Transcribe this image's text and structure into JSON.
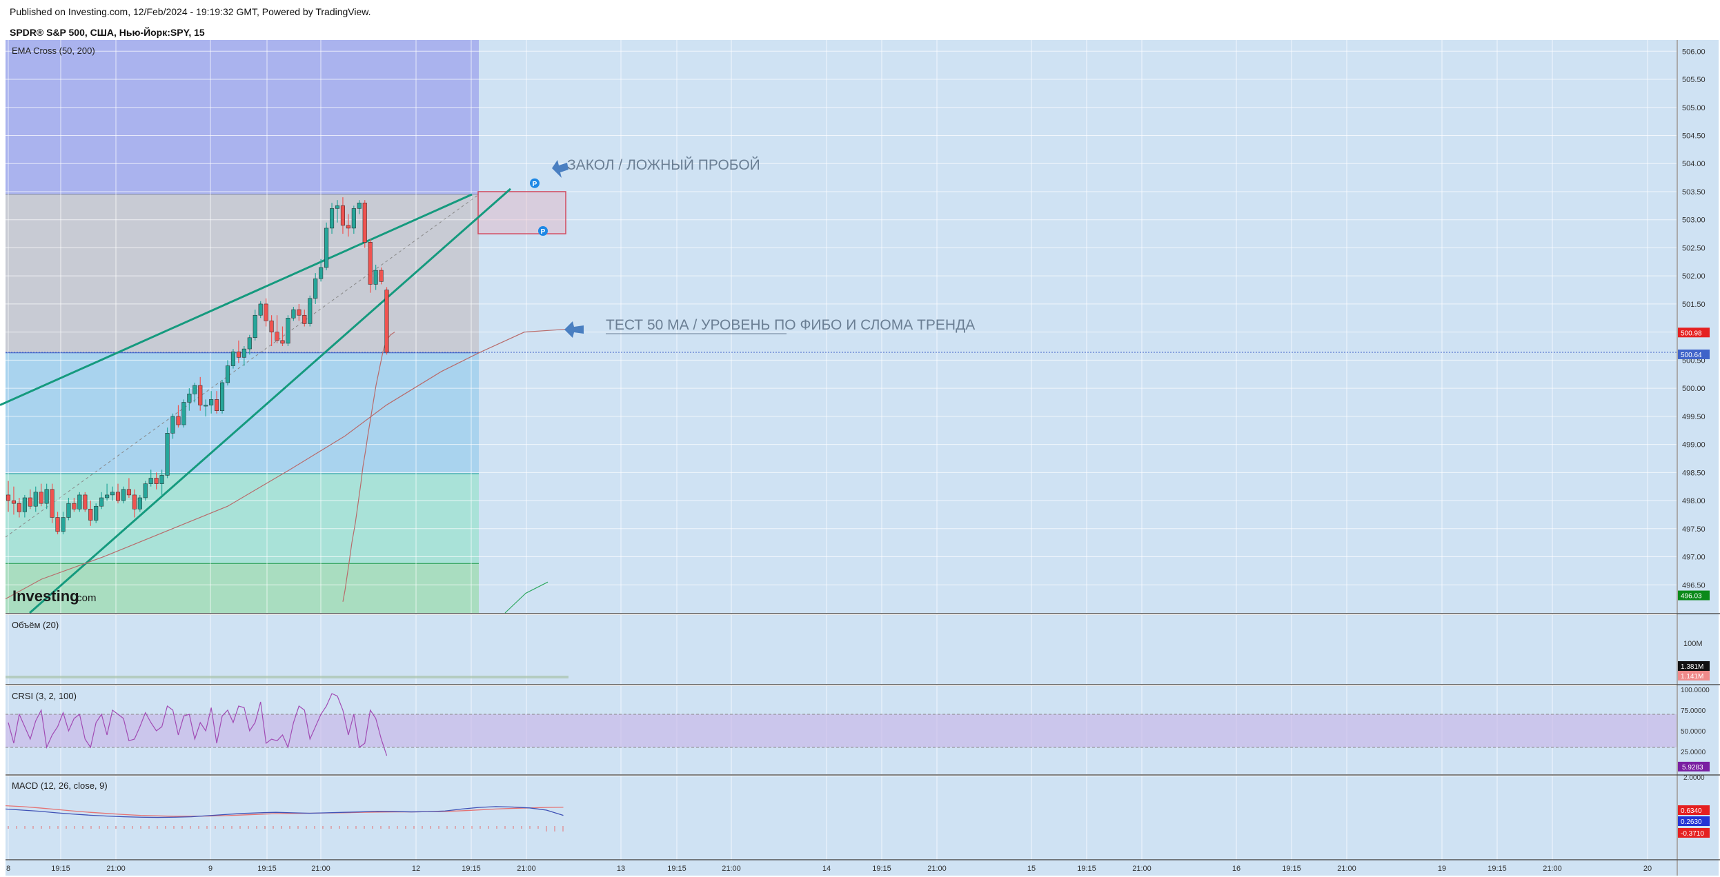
{
  "header": {
    "published": "Published on Investing.com, 12/Feb/2024 - 19:19:32 GMT, Powered by TradingView.",
    "symbol": "SPDR® S&P 500, США, Нью-Йорк:SPY, 15"
  },
  "watermark": {
    "brand": "Investing",
    "suffix": ".com"
  },
  "colors": {
    "background": "#ffffff",
    "panel": "#cfe2f3",
    "grid": "#ffffff",
    "up": "#26a69a",
    "down": "#ef5350",
    "trend": "#159a7e",
    "ema": "#b86b6b",
    "annotation_arrow": "#4a7fc1",
    "fib_purple": "#aab3ee",
    "fib_grey": "#c8cbd4",
    "fib_blue": "#a9d3ee",
    "fib_teal": "#a9e2d8",
    "fib_green": "#a9ddc0"
  },
  "chart_data": {
    "type": "candlestick",
    "interval": "15",
    "main_indicator": "EMA Cross (50, 200)",
    "ylim": [
      496.0,
      506.2
    ],
    "y_ticks": [
      "506.00",
      "505.50",
      "505.00",
      "504.50",
      "504.00",
      "503.50",
      "503.00",
      "502.50",
      "502.00",
      "501.50",
      "501.00",
      "500.50",
      "500.00",
      "499.50",
      "499.00",
      "498.50",
      "498.00",
      "497.50",
      "497.00",
      "496.50"
    ],
    "x_ticks": [
      "8",
      "19:15",
      "21:00",
      "9",
      "19:15",
      "21:00",
      "12",
      "19:15",
      "21:00",
      "13",
      "19:15",
      "21:00",
      "14",
      "19:15",
      "21:00",
      "15",
      "19:15",
      "21:00",
      "16",
      "19:15",
      "21:00",
      "19",
      "19:15",
      "21:00",
      "20"
    ],
    "price_labels": [
      {
        "value": "500.98",
        "color": "#e52020"
      },
      {
        "value": "500.64",
        "color": "#3f63c9"
      },
      {
        "value": "496.03",
        "color": "#0b8a1a"
      }
    ],
    "ohlc": [
      [
        498.1,
        498.35,
        497.8,
        498.0
      ],
      [
        498.0,
        498.25,
        497.75,
        497.95
      ],
      [
        497.95,
        498.05,
        497.7,
        497.8
      ],
      [
        497.8,
        498.1,
        497.7,
        498.05
      ],
      [
        498.05,
        498.2,
        497.85,
        497.9
      ],
      [
        497.9,
        498.25,
        497.8,
        498.15
      ],
      [
        498.15,
        498.3,
        497.9,
        497.95
      ],
      [
        497.95,
        498.3,
        497.85,
        498.2
      ],
      [
        498.2,
        498.3,
        497.6,
        497.7
      ],
      [
        497.7,
        497.8,
        497.4,
        497.45
      ],
      [
        497.45,
        497.8,
        497.4,
        497.7
      ],
      [
        497.7,
        498.05,
        497.65,
        497.95
      ],
      [
        497.95,
        498.05,
        497.8,
        497.85
      ],
      [
        497.85,
        498.15,
        497.8,
        498.1
      ],
      [
        498.1,
        498.15,
        497.8,
        497.85
      ],
      [
        497.85,
        498.0,
        497.55,
        497.65
      ],
      [
        497.65,
        497.95,
        497.6,
        497.9
      ],
      [
        497.9,
        498.15,
        497.85,
        498.05
      ],
      [
        498.05,
        498.3,
        498.0,
        498.1
      ],
      [
        498.1,
        498.25,
        498.0,
        498.15
      ],
      [
        498.15,
        498.3,
        497.95,
        498.0
      ],
      [
        498.0,
        498.25,
        497.95,
        498.2
      ],
      [
        498.2,
        498.4,
        498.05,
        498.1
      ],
      [
        498.1,
        498.2,
        497.7,
        497.85
      ],
      [
        497.85,
        498.1,
        497.8,
        498.05
      ],
      [
        498.05,
        498.35,
        498.0,
        498.3
      ],
      [
        498.3,
        498.55,
        498.25,
        498.4
      ],
      [
        498.4,
        498.5,
        498.2,
        498.3
      ],
      [
        498.3,
        498.55,
        498.1,
        498.45
      ],
      [
        498.45,
        499.3,
        498.4,
        499.2
      ],
      [
        499.2,
        499.55,
        499.1,
        499.5
      ],
      [
        499.5,
        499.7,
        499.3,
        499.35
      ],
      [
        499.35,
        499.8,
        499.3,
        499.75
      ],
      [
        499.75,
        500.0,
        499.6,
        499.9
      ],
      [
        499.9,
        500.1,
        499.75,
        500.05
      ],
      [
        500.05,
        500.2,
        499.6,
        499.7
      ],
      [
        499.7,
        499.8,
        499.5,
        499.7
      ],
      [
        499.7,
        499.95,
        499.55,
        499.8
      ],
      [
        499.8,
        499.95,
        499.55,
        499.6
      ],
      [
        499.6,
        500.15,
        499.55,
        500.1
      ],
      [
        500.1,
        500.5,
        500.05,
        500.4
      ],
      [
        500.4,
        500.7,
        500.35,
        500.65
      ],
      [
        500.65,
        500.85,
        500.45,
        500.55
      ],
      [
        500.55,
        500.75,
        500.4,
        500.7
      ],
      [
        500.7,
        500.95,
        500.6,
        500.9
      ],
      [
        500.9,
        501.4,
        500.85,
        501.3
      ],
      [
        501.3,
        501.55,
        501.25,
        501.5
      ],
      [
        501.5,
        501.6,
        501.1,
        501.2
      ],
      [
        501.2,
        501.3,
        500.75,
        501.0
      ],
      [
        501.0,
        501.3,
        500.8,
        500.85
      ],
      [
        500.85,
        501.1,
        500.75,
        500.8
      ],
      [
        500.8,
        501.3,
        500.75,
        501.25
      ],
      [
        501.25,
        501.45,
        501.2,
        501.4
      ],
      [
        501.4,
        501.5,
        501.2,
        501.3
      ],
      [
        501.3,
        501.4,
        501.1,
        501.15
      ],
      [
        501.15,
        501.65,
        501.1,
        501.6
      ],
      [
        501.6,
        502.05,
        501.5,
        501.95
      ],
      [
        501.95,
        502.3,
        501.9,
        502.15
      ],
      [
        502.15,
        502.95,
        502.1,
        502.85
      ],
      [
        502.85,
        503.3,
        502.75,
        503.2
      ],
      [
        503.2,
        503.35,
        502.95,
        503.25
      ],
      [
        503.25,
        503.4,
        502.75,
        502.9
      ],
      [
        502.9,
        503.1,
        502.7,
        502.85
      ],
      [
        502.85,
        503.25,
        502.75,
        503.2
      ],
      [
        503.2,
        503.35,
        503.1,
        503.3
      ],
      [
        503.3,
        503.35,
        502.5,
        502.6
      ],
      [
        502.6,
        502.65,
        501.7,
        501.85
      ],
      [
        501.85,
        502.2,
        501.75,
        502.1
      ],
      [
        502.1,
        502.15,
        501.85,
        501.9
      ],
      [
        501.75,
        501.8,
        500.6,
        500.64
      ]
    ],
    "ema50": [
      [
        497.0,
        496.2
      ],
      [
        500.0,
        496.4
      ],
      [
        506.0,
        496.9
      ],
      [
        510.0,
        497.25
      ],
      [
        515.0,
        497.6
      ],
      [
        519.0,
        497.95
      ],
      [
        523.0,
        498.3
      ],
      [
        526.0,
        498.6
      ],
      [
        530.0,
        498.9
      ],
      [
        533.0,
        499.15
      ],
      [
        537.0,
        499.45
      ],
      [
        541.0,
        499.75
      ],
      [
        545.0,
        500.05
      ],
      [
        550.0,
        500.35
      ],
      [
        555.0,
        500.65
      ],
      [
        560.0,
        500.85
      ],
      [
        566.0,
        500.95
      ],
      [
        572.0,
        501.0
      ]
    ],
    "ema200_tail": [
      [
        510.0,
        496.0
      ],
      [
        540.0,
        496.35
      ],
      [
        572.0,
        496.55
      ]
    ],
    "trendlines": [
      {
        "x1": 0,
        "y1": 499.7,
        "x2": 684,
        "y2": 503.45
      },
      {
        "x1": 43,
        "y1": 496.0,
        "x2": 740,
        "y2": 503.55
      }
    ],
    "fib_zones": [
      {
        "name": "top",
        "from": 503.45,
        "to": 506.2,
        "fill": "fib_purple"
      },
      {
        "name": "upper",
        "from": 500.63,
        "to": 503.45,
        "fill": "fib_grey"
      },
      {
        "name": "mid",
        "from": 498.48,
        "to": 500.63,
        "fill": "fib_blue"
      },
      {
        "name": "lower",
        "from": 496.88,
        "to": 498.48,
        "fill": "fib_teal"
      },
      {
        "name": "bottom",
        "from": 496.0,
        "to": 496.88,
        "fill": "fib_green"
      }
    ],
    "annotations": [
      {
        "text": "ЗАКОЛ / ЛОЖНЫЙ ПРОБОЙ"
      },
      {
        "text": "ТЕСТ 50 МА / УРОВЕНЬ ПО ФИБО И СЛОМА ТРЕНДА"
      }
    ],
    "range_box": {
      "from": 502.75,
      "to": 503.5
    },
    "markers": [
      "P",
      "P"
    ],
    "panes": [
      {
        "name": "volume",
        "title": "Объём (20)",
        "ticks": [
          "100M"
        ],
        "labels": [
          {
            "value": "1.381M",
            "color": "#111111"
          },
          {
            "value": "1.141M",
            "color": "#f08a8a"
          }
        ]
      },
      {
        "name": "crsi",
        "title": "CRSI (3, 2, 100)",
        "ticks": [
          "100.0000",
          "75.0000",
          "50.0000",
          "25.0000"
        ],
        "band": [
          30,
          70
        ],
        "labels": [
          {
            "value": "5.9283",
            "color": "#7a1fa2"
          }
        ],
        "values": [
          60,
          35,
          70,
          55,
          40,
          62,
          75,
          30,
          45,
          55,
          72,
          50,
          65,
          70,
          40,
          30,
          60,
          70,
          45,
          75,
          70,
          65,
          38,
          40,
          55,
          72,
          60,
          50,
          55,
          80,
          75,
          45,
          68,
          70,
          40,
          60,
          50,
          78,
          35,
          68,
          75,
          60,
          80,
          78,
          50,
          60,
          85,
          35,
          40,
          38,
          45,
          30,
          60,
          80,
          75,
          40,
          55,
          70,
          80,
          95,
          92,
          75,
          45,
          70,
          30,
          35,
          75,
          65,
          40,
          20
        ]
      },
      {
        "name": "macd",
        "title": "MACD (12, 26, close, 9)",
        "ticks": [
          "2.0000"
        ],
        "labels": [
          {
            "value": "0.6340",
            "color": "#e52020"
          },
          {
            "value": "0.2630",
            "color": "#2434d4"
          },
          {
            "value": "-0.3710",
            "color": "#e52020"
          }
        ],
        "macd": [
          0.55,
          0.5,
          0.45,
          0.38,
          0.32,
          0.27,
          0.23,
          0.2,
          0.18,
          0.17,
          0.18,
          0.2,
          0.25,
          0.3,
          0.35,
          0.38,
          0.4,
          0.38,
          0.36,
          0.38,
          0.4,
          0.42,
          0.45,
          0.44,
          0.42,
          0.43,
          0.46,
          0.55,
          0.62,
          0.66,
          0.64,
          0.6,
          0.5,
          0.26
        ],
        "signal": [
          0.7,
          0.66,
          0.6,
          0.53,
          0.46,
          0.4,
          0.35,
          0.3,
          0.26,
          0.24,
          0.22,
          0.22,
          0.23,
          0.25,
          0.28,
          0.31,
          0.34,
          0.35,
          0.36,
          0.37,
          0.38,
          0.4,
          0.41,
          0.42,
          0.42,
          0.43,
          0.44,
          0.47,
          0.51,
          0.55,
          0.58,
          0.6,
          0.62,
          0.63
        ]
      }
    ]
  }
}
